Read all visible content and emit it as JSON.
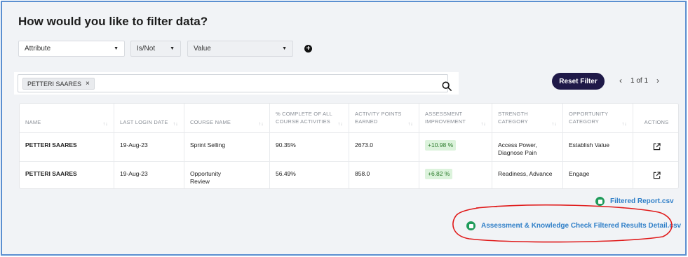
{
  "title": "How would you like to filter data?",
  "filters": {
    "attribute": "Attribute",
    "is_not": "Is/Not",
    "value": "Value",
    "add": "+"
  },
  "search": {
    "chip": "PETTERI SAARES",
    "chip_remove": "×"
  },
  "reset_label": "Reset Filter",
  "pager": {
    "text": "1 of 1",
    "prev": "‹",
    "next": "›"
  },
  "table": {
    "headers": [
      [
        "NAME"
      ],
      [
        "LAST LOGIN DATE"
      ],
      [
        "COURSE NAME"
      ],
      [
        "% COMPLETE OF ALL",
        "COURSE ACTIVITIES"
      ],
      [
        "ACTIVITY POINTS",
        "EARNED"
      ],
      [
        "ASSESSMENT",
        "IMPROVEMENT"
      ],
      [
        "STRENGTH",
        "CATEGORY"
      ],
      [
        "OPPORTUNITY",
        "CATEGORY"
      ],
      [
        "ACTIONS"
      ]
    ],
    "rows": [
      {
        "name": "PETTERI SAARES",
        "last_login": "19-Aug-23",
        "course": [
          "Sprint Selling"
        ],
        "complete": "90.35%",
        "points": "2673.0",
        "improvement": "+10.98 %",
        "strength": [
          "Access Power,",
          "Diagnose Pain"
        ],
        "opportunity": "Establish Value"
      },
      {
        "name": "PETTERI SAARES",
        "last_login": "19-Aug-23",
        "course": [
          "Opportunity",
          "Review"
        ],
        "complete": "56.49%",
        "points": "858.0",
        "improvement": "+6.82 %",
        "strength": [
          "Readiness, Advance"
        ],
        "opportunity": "Engage"
      }
    ]
  },
  "downloads": {
    "filtered_report": "Filtered Report.csv",
    "assessment_detail": "Assessment & Knowledge Check Filtered Results Detail.csv"
  },
  "colors": {
    "accent_dark": "#1f1948",
    "link": "#2f7fc8",
    "excel": "#1f9b5a",
    "annotation": "#e01a1a"
  },
  "sort_glyph": "↑↓"
}
